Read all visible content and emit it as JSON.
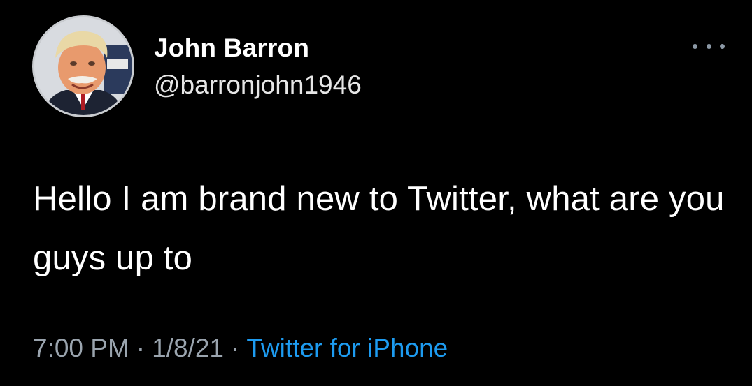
{
  "tweet": {
    "author": {
      "display_name": "John Barron",
      "handle": "@barronjohn1946",
      "avatar_icon": "profile-photo"
    },
    "text": "Hello I am brand new to Twitter, what are you guys up to",
    "time": "7:00 PM",
    "date": "1/8/21",
    "separator": "·",
    "source": "Twitter for iPhone",
    "more_icon": "more-dots-icon"
  },
  "colors": {
    "background": "#000000",
    "text": "#ffffff",
    "secondary": "#9aa4ae",
    "link": "#1d9bf0"
  }
}
